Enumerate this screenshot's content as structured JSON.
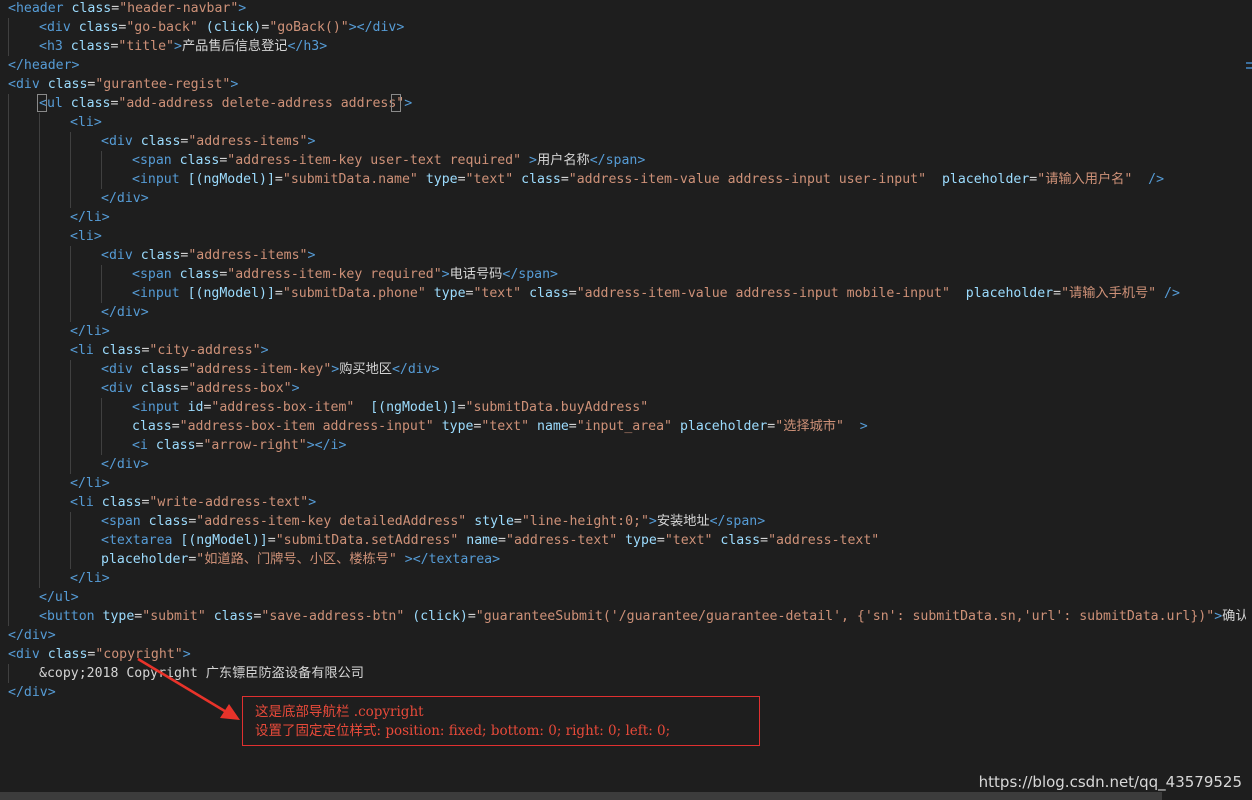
{
  "code_lines": [
    {
      "indent": 0,
      "tokens": [
        [
          "tag",
          "<header "
        ],
        [
          "attr",
          "class"
        ],
        [
          "txt",
          "="
        ],
        [
          "str",
          "\"header-navbar\""
        ],
        [
          "tag",
          ">"
        ]
      ]
    },
    {
      "indent": 1,
      "tokens": [
        [
          "tag",
          "<div "
        ],
        [
          "attr",
          "class"
        ],
        [
          "txt",
          "="
        ],
        [
          "str",
          "\"go-back\""
        ],
        [
          "txt",
          " "
        ],
        [
          "attr",
          "(click)"
        ],
        [
          "txt",
          "="
        ],
        [
          "str",
          "\"goBack()\""
        ],
        [
          "tag",
          "></div>"
        ]
      ]
    },
    {
      "indent": 1,
      "tokens": [
        [
          "tag",
          "<h3 "
        ],
        [
          "attr",
          "class"
        ],
        [
          "txt",
          "="
        ],
        [
          "str",
          "\"title\""
        ],
        [
          "tag",
          ">"
        ],
        [
          "txt",
          "产品售后信息登记"
        ],
        [
          "tag",
          "</h3>"
        ]
      ]
    },
    {
      "indent": 0,
      "tokens": [
        [
          "tag",
          "</header>"
        ]
      ]
    },
    {
      "indent": 0,
      "tokens": [
        [
          "tag",
          "<div "
        ],
        [
          "attr",
          "class"
        ],
        [
          "txt",
          "="
        ],
        [
          "str",
          "\"gurantee-regist\""
        ],
        [
          "tag",
          ">"
        ]
      ]
    },
    {
      "indent": 1,
      "tokens": [
        [
          "tag",
          "<ul "
        ],
        [
          "attr",
          "class"
        ],
        [
          "txt",
          "="
        ],
        [
          "str",
          "\"add-address delete-address address\""
        ],
        [
          "tag",
          ">"
        ]
      ]
    },
    {
      "indent": 2,
      "tokens": [
        [
          "tag",
          "<li>"
        ]
      ]
    },
    {
      "indent": 3,
      "tokens": [
        [
          "tag",
          "<div "
        ],
        [
          "attr",
          "class"
        ],
        [
          "txt",
          "="
        ],
        [
          "str",
          "\"address-items\""
        ],
        [
          "tag",
          ">"
        ]
      ]
    },
    {
      "indent": 4,
      "tokens": [
        [
          "tag",
          "<span "
        ],
        [
          "attr",
          "class"
        ],
        [
          "txt",
          "="
        ],
        [
          "str",
          "\"address-item-key user-text required\""
        ],
        [
          "txt",
          " "
        ],
        [
          "tag",
          ">"
        ],
        [
          "txt",
          "用户名称"
        ],
        [
          "tag",
          "</span>"
        ]
      ]
    },
    {
      "indent": 4,
      "tokens": [
        [
          "tag",
          "<input "
        ],
        [
          "attr",
          "[(ngModel)]"
        ],
        [
          "txt",
          "="
        ],
        [
          "str",
          "\"submitData.name\""
        ],
        [
          "txt",
          " "
        ],
        [
          "attr",
          "type"
        ],
        [
          "txt",
          "="
        ],
        [
          "str",
          "\"text\""
        ],
        [
          "txt",
          " "
        ],
        [
          "attr",
          "class"
        ],
        [
          "txt",
          "="
        ],
        [
          "str",
          "\"address-item-value address-input user-input\""
        ],
        [
          "txt",
          "  "
        ],
        [
          "attr",
          "placeholder"
        ],
        [
          "txt",
          "="
        ],
        [
          "str",
          "\"请输入用户名\""
        ],
        [
          "txt",
          "  "
        ],
        [
          "tag",
          "/>"
        ]
      ]
    },
    {
      "indent": 3,
      "tokens": [
        [
          "tag",
          "</div>"
        ]
      ]
    },
    {
      "indent": 2,
      "tokens": [
        [
          "tag",
          "</li>"
        ]
      ]
    },
    {
      "indent": 2,
      "tokens": [
        [
          "tag",
          "<li>"
        ]
      ]
    },
    {
      "indent": 3,
      "tokens": [
        [
          "tag",
          "<div "
        ],
        [
          "attr",
          "class"
        ],
        [
          "txt",
          "="
        ],
        [
          "str",
          "\"address-items\""
        ],
        [
          "tag",
          ">"
        ]
      ]
    },
    {
      "indent": 4,
      "tokens": [
        [
          "tag",
          "<span "
        ],
        [
          "attr",
          "class"
        ],
        [
          "txt",
          "="
        ],
        [
          "str",
          "\"address-item-key required\""
        ],
        [
          "tag",
          ">"
        ],
        [
          "txt",
          "电话号码"
        ],
        [
          "tag",
          "</span>"
        ]
      ]
    },
    {
      "indent": 4,
      "tokens": [
        [
          "tag",
          "<input "
        ],
        [
          "attr",
          "[(ngModel)]"
        ],
        [
          "txt",
          "="
        ],
        [
          "str",
          "\"submitData.phone\""
        ],
        [
          "txt",
          " "
        ],
        [
          "attr",
          "type"
        ],
        [
          "txt",
          "="
        ],
        [
          "str",
          "\"text\""
        ],
        [
          "txt",
          " "
        ],
        [
          "attr",
          "class"
        ],
        [
          "txt",
          "="
        ],
        [
          "str",
          "\"address-item-value address-input mobile-input\""
        ],
        [
          "txt",
          "  "
        ],
        [
          "attr",
          "placeholder"
        ],
        [
          "txt",
          "="
        ],
        [
          "str",
          "\"请输入手机号\""
        ],
        [
          "txt",
          " "
        ],
        [
          "tag",
          "/>"
        ]
      ]
    },
    {
      "indent": 3,
      "tokens": [
        [
          "tag",
          "</div>"
        ]
      ]
    },
    {
      "indent": 2,
      "tokens": [
        [
          "tag",
          "</li>"
        ]
      ]
    },
    {
      "indent": 2,
      "tokens": [
        [
          "tag",
          "<li "
        ],
        [
          "attr",
          "class"
        ],
        [
          "txt",
          "="
        ],
        [
          "str",
          "\"city-address\""
        ],
        [
          "tag",
          ">"
        ]
      ]
    },
    {
      "indent": 3,
      "tokens": [
        [
          "tag",
          "<div "
        ],
        [
          "attr",
          "class"
        ],
        [
          "txt",
          "="
        ],
        [
          "str",
          "\"address-item-key\""
        ],
        [
          "tag",
          ">"
        ],
        [
          "txt",
          "购买地区"
        ],
        [
          "tag",
          "</div>"
        ]
      ]
    },
    {
      "indent": 3,
      "tokens": [
        [
          "tag",
          "<div "
        ],
        [
          "attr",
          "class"
        ],
        [
          "txt",
          "="
        ],
        [
          "str",
          "\"address-box\""
        ],
        [
          "tag",
          ">"
        ]
      ]
    },
    {
      "indent": 4,
      "tokens": [
        [
          "tag",
          "<input "
        ],
        [
          "attr",
          "id"
        ],
        [
          "txt",
          "="
        ],
        [
          "str",
          "\"address-box-item\""
        ],
        [
          "txt",
          "  "
        ],
        [
          "attr",
          "[(ngModel)]"
        ],
        [
          "txt",
          "="
        ],
        [
          "str",
          "\"submitData.buyAddress\""
        ]
      ]
    },
    {
      "indent": 4,
      "tokens": [
        [
          "attr",
          "class"
        ],
        [
          "txt",
          "="
        ],
        [
          "str",
          "\"address-box-item address-input\""
        ],
        [
          "txt",
          " "
        ],
        [
          "attr",
          "type"
        ],
        [
          "txt",
          "="
        ],
        [
          "str",
          "\"text\""
        ],
        [
          "txt",
          " "
        ],
        [
          "attr",
          "name"
        ],
        [
          "txt",
          "="
        ],
        [
          "str",
          "\"input_area\""
        ],
        [
          "txt",
          " "
        ],
        [
          "attr",
          "placeholder"
        ],
        [
          "txt",
          "="
        ],
        [
          "str",
          "\"选择城市\""
        ],
        [
          "txt",
          "  "
        ],
        [
          "tag",
          ">"
        ]
      ]
    },
    {
      "indent": 4,
      "tokens": [
        [
          "tag",
          "<i "
        ],
        [
          "attr",
          "class"
        ],
        [
          "txt",
          "="
        ],
        [
          "str",
          "\"arrow-right\""
        ],
        [
          "tag",
          "></i>"
        ]
      ]
    },
    {
      "indent": 3,
      "tokens": [
        [
          "tag",
          "</div>"
        ]
      ]
    },
    {
      "indent": 2,
      "tokens": [
        [
          "tag",
          "</li>"
        ]
      ]
    },
    {
      "indent": 2,
      "tokens": [
        [
          "tag",
          "<li "
        ],
        [
          "attr",
          "class"
        ],
        [
          "txt",
          "="
        ],
        [
          "str",
          "\"write-address-text\""
        ],
        [
          "tag",
          ">"
        ]
      ]
    },
    {
      "indent": 3,
      "tokens": [
        [
          "tag",
          "<span "
        ],
        [
          "attr",
          "class"
        ],
        [
          "txt",
          "="
        ],
        [
          "str",
          "\"address-item-key detailedAddress\""
        ],
        [
          "txt",
          " "
        ],
        [
          "attr",
          "style"
        ],
        [
          "txt",
          "="
        ],
        [
          "str",
          "\"line-height:0;\""
        ],
        [
          "tag",
          ">"
        ],
        [
          "txt",
          "安装地址"
        ],
        [
          "tag",
          "</span>"
        ]
      ]
    },
    {
      "indent": 3,
      "tokens": [
        [
          "tag",
          "<textarea "
        ],
        [
          "attr",
          "[(ngModel)]"
        ],
        [
          "txt",
          "="
        ],
        [
          "str",
          "\"submitData.setAddress\""
        ],
        [
          "txt",
          " "
        ],
        [
          "attr",
          "name"
        ],
        [
          "txt",
          "="
        ],
        [
          "str",
          "\"address-text\""
        ],
        [
          "txt",
          " "
        ],
        [
          "attr",
          "type"
        ],
        [
          "txt",
          "="
        ],
        [
          "str",
          "\"text\""
        ],
        [
          "txt",
          " "
        ],
        [
          "attr",
          "class"
        ],
        [
          "txt",
          "="
        ],
        [
          "str",
          "\"address-text\""
        ]
      ]
    },
    {
      "indent": 3,
      "tokens": [
        [
          "attr",
          "placeholder"
        ],
        [
          "txt",
          "="
        ],
        [
          "str",
          "\"如道路、门牌号、小区、楼栋号\""
        ],
        [
          "txt",
          " "
        ],
        [
          "tag",
          "></textarea>"
        ]
      ]
    },
    {
      "indent": 2,
      "tokens": [
        [
          "tag",
          "</li>"
        ]
      ]
    },
    {
      "indent": 1,
      "tokens": [
        [
          "tag",
          "</ul>"
        ]
      ]
    },
    {
      "indent": 1,
      "tokens": [
        [
          "tag",
          "<button "
        ],
        [
          "attr",
          "type"
        ],
        [
          "txt",
          "="
        ],
        [
          "str",
          "\"submit\""
        ],
        [
          "txt",
          " "
        ],
        [
          "attr",
          "class"
        ],
        [
          "txt",
          "="
        ],
        [
          "str",
          "\"save-address-btn\""
        ],
        [
          "txt",
          " "
        ],
        [
          "attr",
          "(click)"
        ],
        [
          "txt",
          "="
        ],
        [
          "str",
          "\"guaranteeSubmit('/guarantee/guarantee-detail', {'sn': submitData.sn,'url': submitData.url})\""
        ],
        [
          "tag",
          ">"
        ],
        [
          "txt",
          "确认提交"
        ],
        [
          "tag",
          "<"
        ]
      ]
    },
    {
      "indent": 0,
      "tokens": [
        [
          "tag",
          "</div>"
        ]
      ]
    },
    {
      "indent": 0,
      "tokens": [
        [
          "tag",
          "<div "
        ],
        [
          "attr",
          "class"
        ],
        [
          "txt",
          "="
        ],
        [
          "str",
          "\"copyright\""
        ],
        [
          "tag",
          ">"
        ]
      ]
    },
    {
      "indent": 1,
      "tokens": [
        [
          "txt",
          "&copy;2018 Copyright 广东镖臣防盗设备有限公司"
        ]
      ]
    },
    {
      "indent": 0,
      "tokens": [
        [
          "tag",
          "</div>"
        ]
      ]
    }
  ],
  "annotation": {
    "line1": "这是底部导航栏 .copyright",
    "line2": "设置了固定定位样式: position: fixed; bottom: 0; right: 0; left: 0;"
  },
  "watermark": "https://blog.csdn.net/qq_43579525",
  "colors": {
    "background": "#1e1e1e",
    "tag": "#569cd6",
    "attribute": "#9cdcfe",
    "string": "#ce9178",
    "text": "#d4d4d4",
    "annotation": "#e84a3a"
  }
}
